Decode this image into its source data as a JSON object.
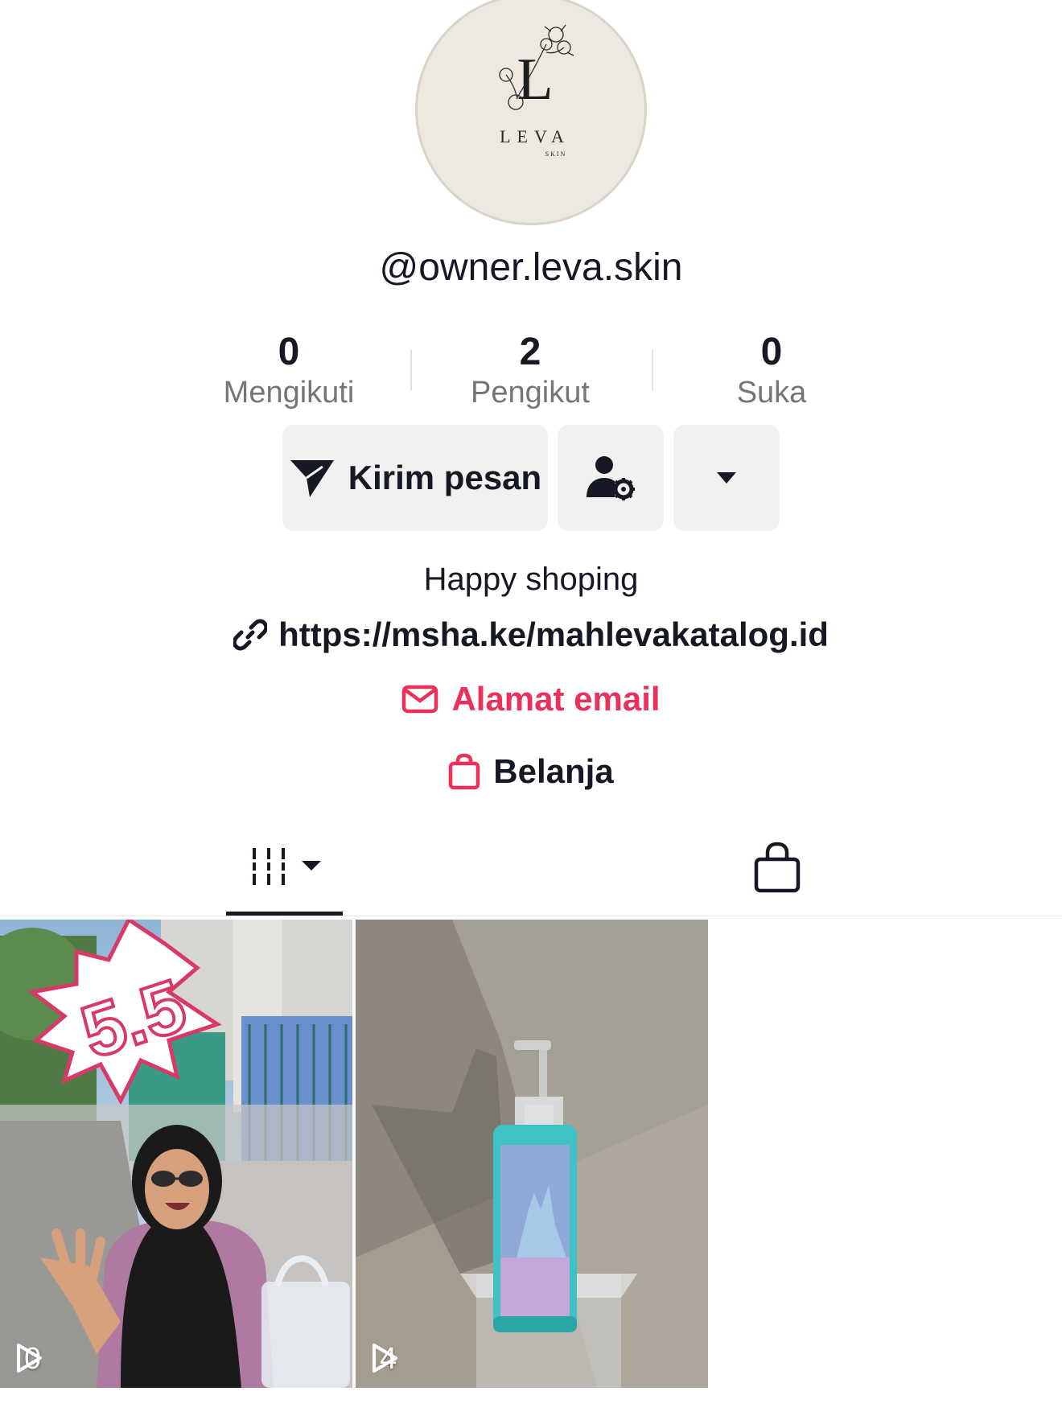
{
  "profile": {
    "avatar_brand": "LEVA",
    "avatar_sub": "SKIN",
    "avatar_letter": "L",
    "username": "@owner.leva.skin"
  },
  "stats": [
    {
      "value": "0",
      "label": "Mengikuti"
    },
    {
      "value": "2",
      "label": "Pengikut"
    },
    {
      "value": "0",
      "label": "Suka"
    }
  ],
  "actions": {
    "message_label": "Kirim pesan"
  },
  "bio": {
    "text": "Happy shoping",
    "link": "https://msha.ke/mahlevakatalog.id",
    "email_label": "Alamat email",
    "shop_label": "Belanja"
  },
  "videos": [
    {
      "views": "0",
      "sticker_text": "5.5"
    },
    {
      "views": "4"
    }
  ],
  "colors": {
    "accent": "#e8315b",
    "text": "#161823",
    "muted": "#757575",
    "button_bg": "#f1f1f2"
  }
}
